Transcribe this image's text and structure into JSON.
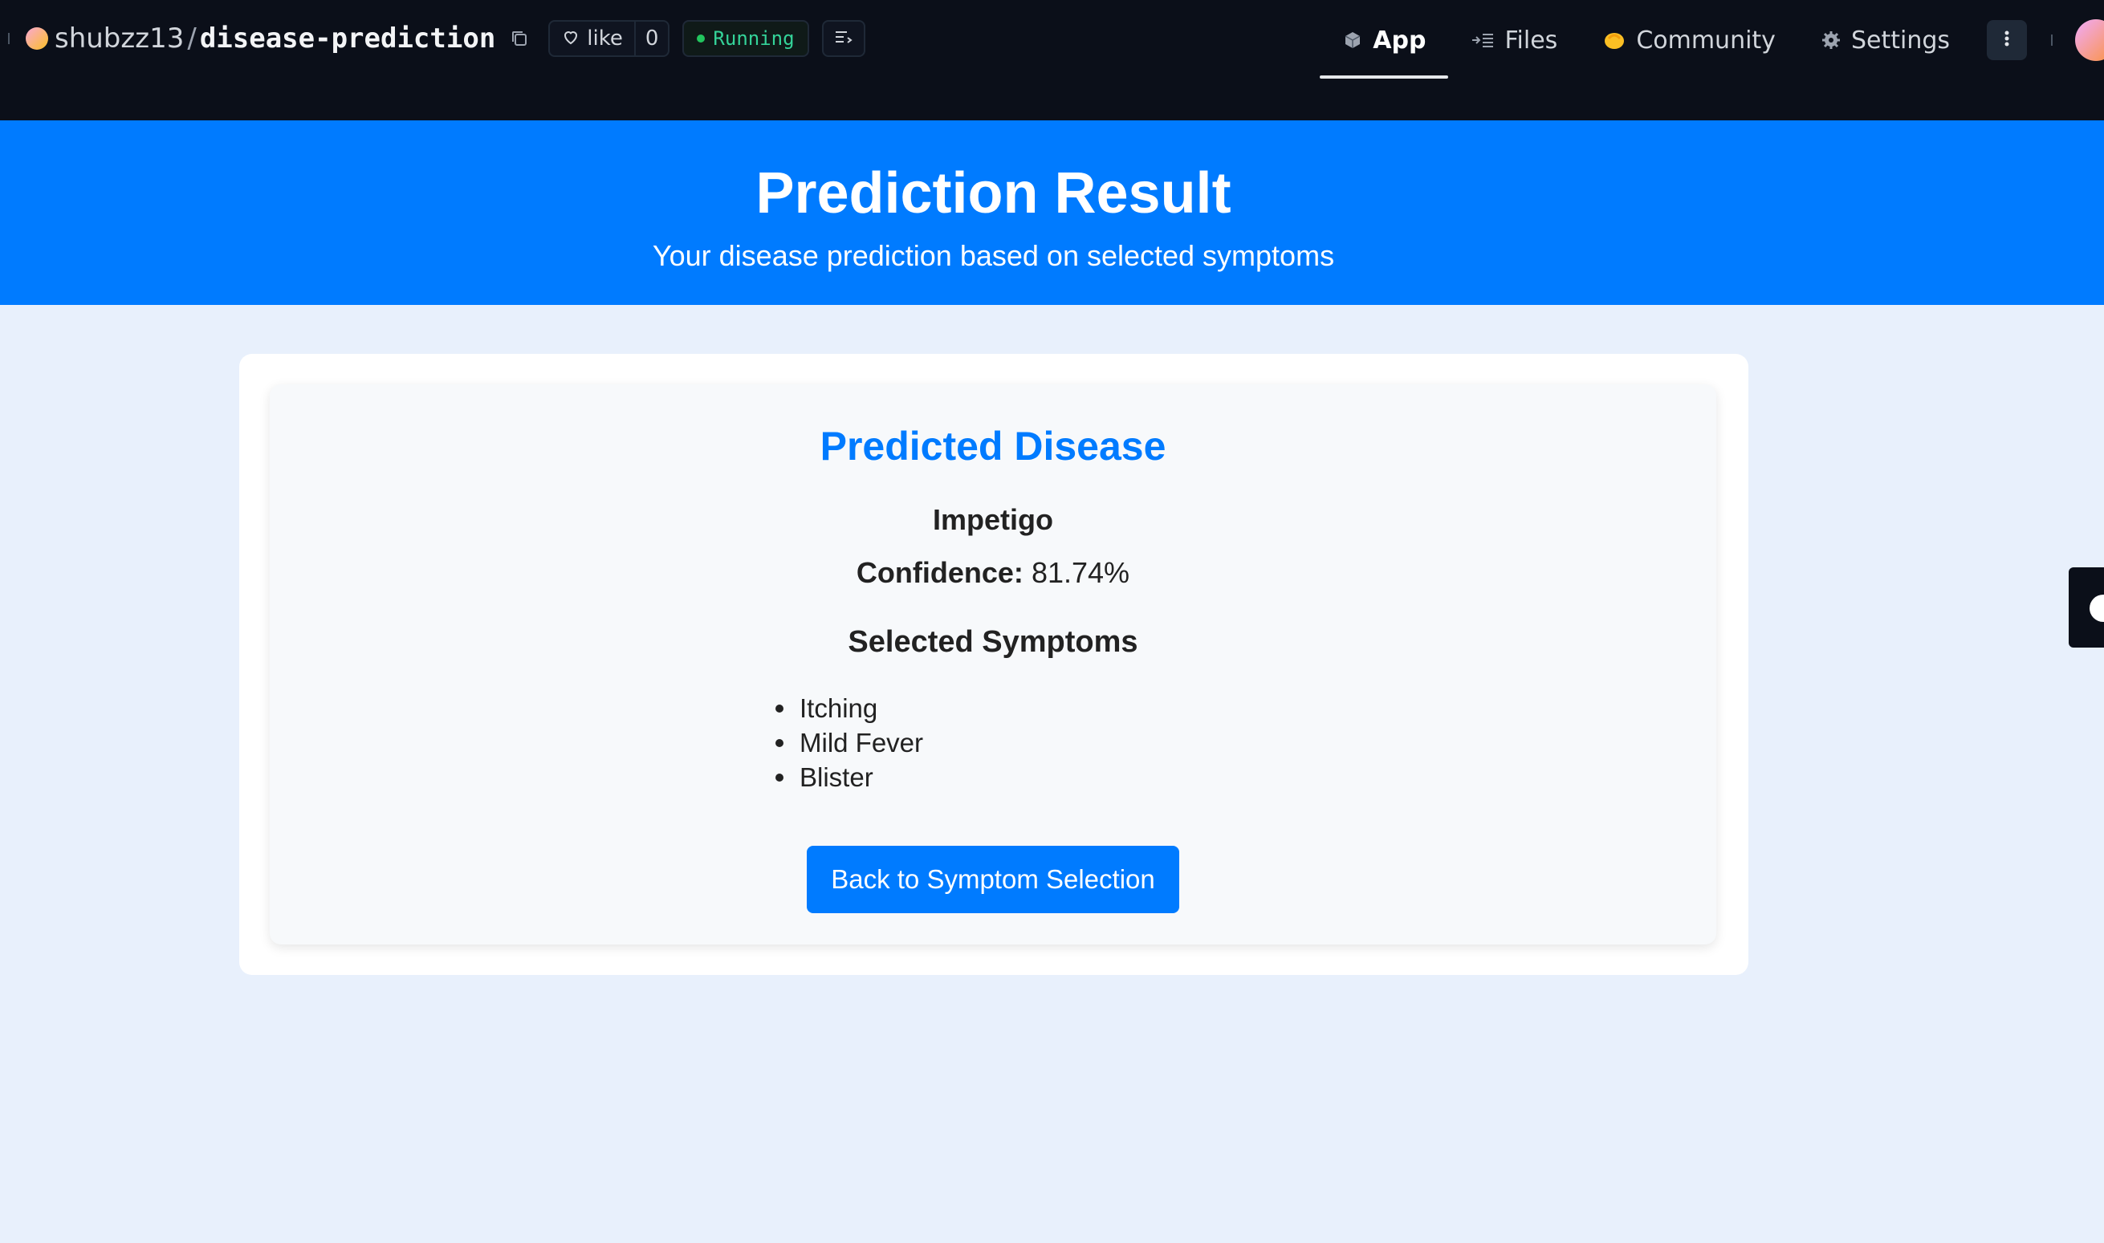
{
  "topbar": {
    "owner": "shubzz13",
    "separator": "/",
    "repo": "disease-prediction",
    "like_label": "like",
    "like_count": "0",
    "status": "Running",
    "status_color": "#34d399",
    "icons": [
      "copy-icon",
      "heart-icon",
      "logs-icon",
      "app-icon",
      "files-icon",
      "community-icon",
      "gear-icon",
      "kebab-icon"
    ],
    "tabs": [
      {
        "label": "App",
        "active": true
      },
      {
        "label": "Files",
        "active": false
      },
      {
        "label": "Community",
        "active": false
      },
      {
        "label": "Settings",
        "active": false
      }
    ]
  },
  "header": {
    "title": "Prediction Result",
    "subtitle": "Your disease prediction based on selected symptoms",
    "background": "#007bff"
  },
  "result": {
    "heading": "Predicted Disease",
    "disease": "Impetigo",
    "confidence_label": "Confidence:",
    "confidence_value": "81.74%",
    "symptoms_heading": "Selected Symptoms",
    "symptoms": [
      "Itching",
      "Mild Fever",
      "Blister"
    ],
    "back_button": "Back to Symptom Selection",
    "accent": "#007bff"
  }
}
